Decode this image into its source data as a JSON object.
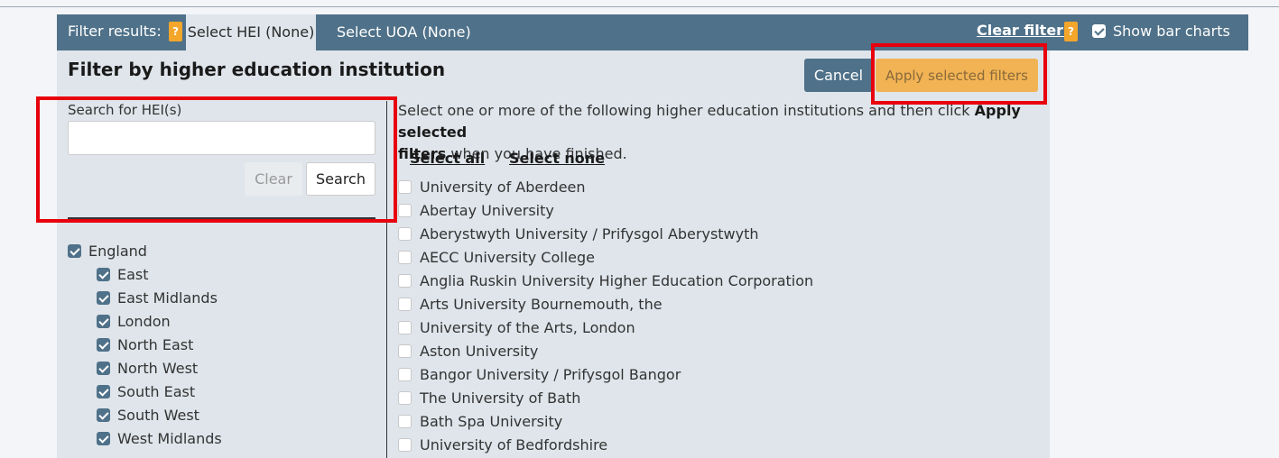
{
  "tabbar": {
    "filter_label": "Filter results:",
    "help_badge": "?",
    "tab_hei": "Select HEI (None)",
    "tab_uoa": "Select UOA (None)",
    "clear_filters": "Clear filters",
    "show_bar_charts": "Show bar charts"
  },
  "panel": {
    "title": "Filter by higher education institution",
    "cancel": "Cancel",
    "apply": "Apply selected filters"
  },
  "search": {
    "label": "Search for HEI(s)",
    "value": "",
    "clear": "Clear",
    "search": "Search"
  },
  "regions": [
    {
      "label": "England",
      "checked": true,
      "child": false
    },
    {
      "label": "East",
      "checked": true,
      "child": true
    },
    {
      "label": "East Midlands",
      "checked": true,
      "child": true
    },
    {
      "label": "London",
      "checked": true,
      "child": true
    },
    {
      "label": "North East",
      "checked": true,
      "child": true
    },
    {
      "label": "North West",
      "checked": true,
      "child": true
    },
    {
      "label": "South East",
      "checked": true,
      "child": true
    },
    {
      "label": "South West",
      "checked": true,
      "child": true
    },
    {
      "label": "West Midlands",
      "checked": true,
      "child": true
    }
  ],
  "instructions": {
    "part1": "Select one or more of the following higher education institutions and then click ",
    "bold1": "Apply selected",
    "bold2": "filters",
    "part2": " when you have finished."
  },
  "select_all": "Select all",
  "select_none": "Select none",
  "institutions": [
    "University of Aberdeen",
    "Abertay University",
    "Aberystwyth University / Prifysgol Aberystwyth",
    "AECC University College",
    "Anglia Ruskin University Higher Education Corporation",
    "Arts University Bournemouth, the",
    "University of the Arts, London",
    "Aston University",
    "Bangor University / Prifysgol Bangor",
    "The University of Bath",
    "Bath Spa University",
    "University of Bedfordshire"
  ],
  "colors": {
    "bar": "#4f7189",
    "panel": "#dfe5eb",
    "accent": "#f4a62a",
    "highlight": "#e8000d"
  }
}
